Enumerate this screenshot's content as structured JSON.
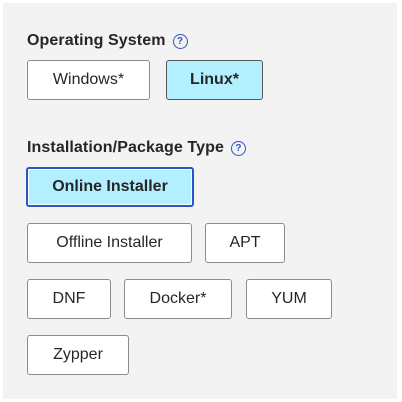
{
  "os_section": {
    "title": "Operating System",
    "help_glyph": "?",
    "options": [
      {
        "label": "Windows*",
        "selected": false
      },
      {
        "label": "Linux*",
        "selected": true
      }
    ]
  },
  "pkg_section": {
    "title": "Installation/Package Type",
    "help_glyph": "?",
    "options": [
      {
        "label": "Online Installer",
        "selected": true
      },
      {
        "label": "Offline Installer",
        "selected": false
      },
      {
        "label": "APT",
        "selected": false
      },
      {
        "label": "DNF",
        "selected": false
      },
      {
        "label": "Docker*",
        "selected": false
      },
      {
        "label": "YUM",
        "selected": false
      },
      {
        "label": "Zypper",
        "selected": false
      }
    ]
  },
  "colors": {
    "selected_bg": "#b4efff",
    "accent": "#2a55c4",
    "panel_bg": "#f3f3f4"
  }
}
